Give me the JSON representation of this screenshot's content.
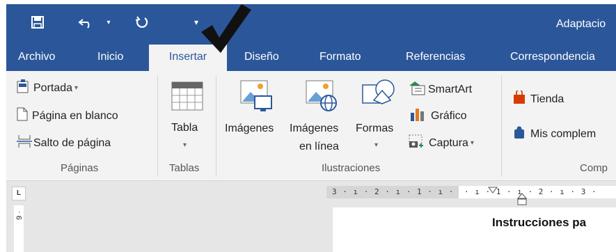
{
  "quick_access": {
    "save_icon": "save-icon",
    "undo_icon": "undo-icon",
    "redo_icon": "redo-icon",
    "customize_icon": "customize-quick-access-icon"
  },
  "window": {
    "title": "Adaptacio"
  },
  "overlay": {
    "icon": "checkmark-icon"
  },
  "tabs": [
    {
      "label": "Archivo"
    },
    {
      "label": "Inicio"
    },
    {
      "label": "Insertar"
    },
    {
      "label": "Diseño"
    },
    {
      "label": "Formato"
    },
    {
      "label": "Referencias"
    },
    {
      "label": "Correspondencia"
    }
  ],
  "ribbon": {
    "paginas": {
      "label": "Páginas",
      "portada": "Portada",
      "pagina_en_blanco": "Página en blanco",
      "salto_de_pagina": "Salto de página"
    },
    "tablas": {
      "label": "Tablas",
      "tabla": "Tabla"
    },
    "ilustraciones": {
      "label": "Ilustraciones",
      "imagenes": "Imágenes",
      "imagenes_linea_1": "Imágenes",
      "imagenes_linea_2": "en línea",
      "formas": "Formas",
      "smartart": "SmartArt",
      "grafico": "Gráfico",
      "captura": "Captura"
    },
    "complementos": {
      "label": "Comp",
      "tienda": "Tienda",
      "mis_complementos": "Mis complem"
    }
  },
  "ruler": {
    "corner": "L",
    "horizontal_left": "3 · ı · 2 · ı · 1 · ı ·",
    "horizontal_right": "· ı · 1 · ı · 2 · ı · 3 ·",
    "vertical": "9 ·"
  },
  "document": {
    "heading": "Instrucciones pa"
  },
  "colors": {
    "accent": "#2b579a",
    "ribbon_bg": "#f3f3f3",
    "workspace_bg": "#e6e6e6"
  }
}
